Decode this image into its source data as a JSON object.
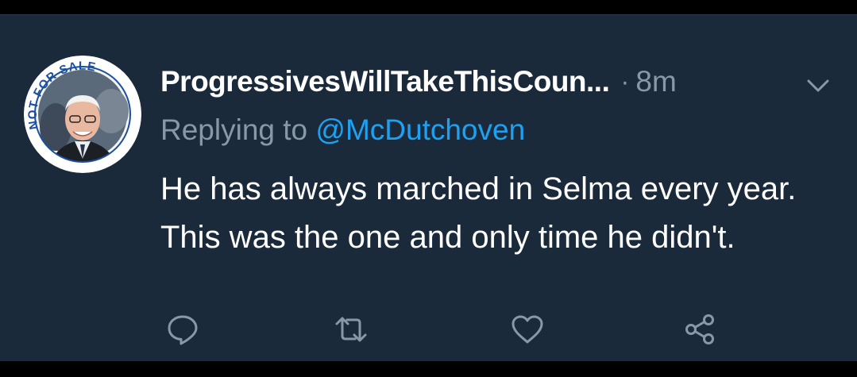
{
  "tweet": {
    "display_name": "ProgressivesWillTakeThisCoun...",
    "separator": "·",
    "timestamp": "8m",
    "reply_prefix": "Replying to ",
    "reply_handle": "@McDutchoven",
    "body": "He has always marched in Selma every year. This was the one and only time he didn't.",
    "avatar_text": "NOT FOR SALE"
  },
  "actions": [
    {
      "name": "reply-icon"
    },
    {
      "name": "retweet-icon"
    },
    {
      "name": "like-icon"
    },
    {
      "name": "share-icon"
    }
  ],
  "colors": {
    "background": "#1a2a3b",
    "secondary_text": "#8899a6",
    "link": "#1da1f2",
    "primary_text": "#ffffff"
  }
}
